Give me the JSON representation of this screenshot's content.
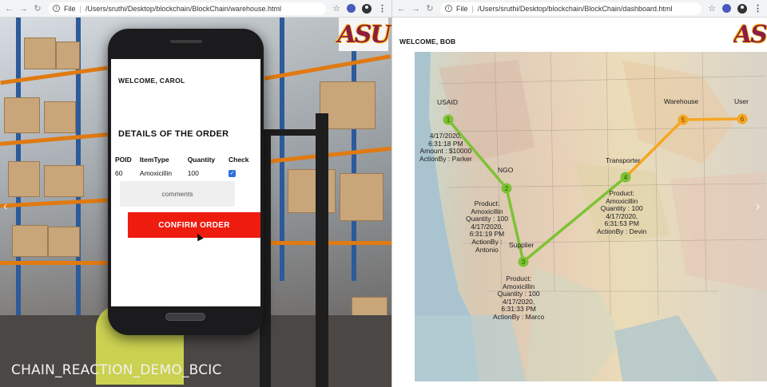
{
  "left_browser": {
    "nav_back": "←",
    "nav_forward": "→",
    "reload": "↻",
    "info": "i",
    "scheme": "File",
    "separator": "|",
    "url": "/Users/sruthi/Desktop/blockchain/BlockChain/warehouse.html",
    "star": "☆",
    "menu": "⋮"
  },
  "right_browser": {
    "nav_back": "←",
    "nav_forward": "→",
    "reload": "↻",
    "info": "i",
    "scheme": "File",
    "separator": "|",
    "url": "/Users/sruthi/Desktop/blockchain/BlockChain/dashboard.html",
    "star": "☆",
    "menu": "⋮"
  },
  "logo_text": "ASU",
  "warehouse_page": {
    "welcome": "WELCOME, CAROL",
    "details_title": "DETAILS OF THE ORDER",
    "table": {
      "headers": [
        "POID",
        "ItemType",
        "Quantity",
        "Check"
      ],
      "rows": [
        [
          "60",
          "Amoxicillin",
          "100"
        ]
      ],
      "checked": true,
      "check_glyph": "✓"
    },
    "comments_placeholder": "comments",
    "confirm_label": "CONFIRM ORDER"
  },
  "slider_arrows": {
    "left": "‹",
    "right": "›"
  },
  "watermark": "CHAIN_REACTION_DEMO_BCIC",
  "dashboard": {
    "welcome": "WELCOME, BOB",
    "nodes": [
      "1",
      "2",
      "3",
      "4",
      "5",
      "6"
    ],
    "role_labels": {
      "usaid": "USAID",
      "ngo": "NGO",
      "supplier": "Supplier",
      "transporter": "Transporter",
      "warehouse": "Warehouse",
      "user": "User"
    },
    "events": {
      "usaid": [
        "4/17/2020,",
        "6:31:18 PM",
        "Amount : $10000",
        "ActionBy : Parker"
      ],
      "ngo": [
        "Product:",
        "Amoxicillin",
        "Quantity : 100",
        "4/17/2020,",
        "6:31:19 PM",
        "ActionBy :",
        "Antonio"
      ],
      "supplier": [
        "Product:",
        "Amoxicillin",
        "Quantity : 100",
        "4/17/2020,",
        "6:31:33 PM",
        "ActionBy : Marco"
      ],
      "transporter": [
        "Product:",
        "Amoxicillin",
        "Quantity : 100",
        "4/17/2020,",
        "6:31:53 PM",
        "ActionBy : Devin"
      ]
    },
    "colors": {
      "green_path": "#7dc234",
      "orange_path": "#f5a623"
    }
  }
}
